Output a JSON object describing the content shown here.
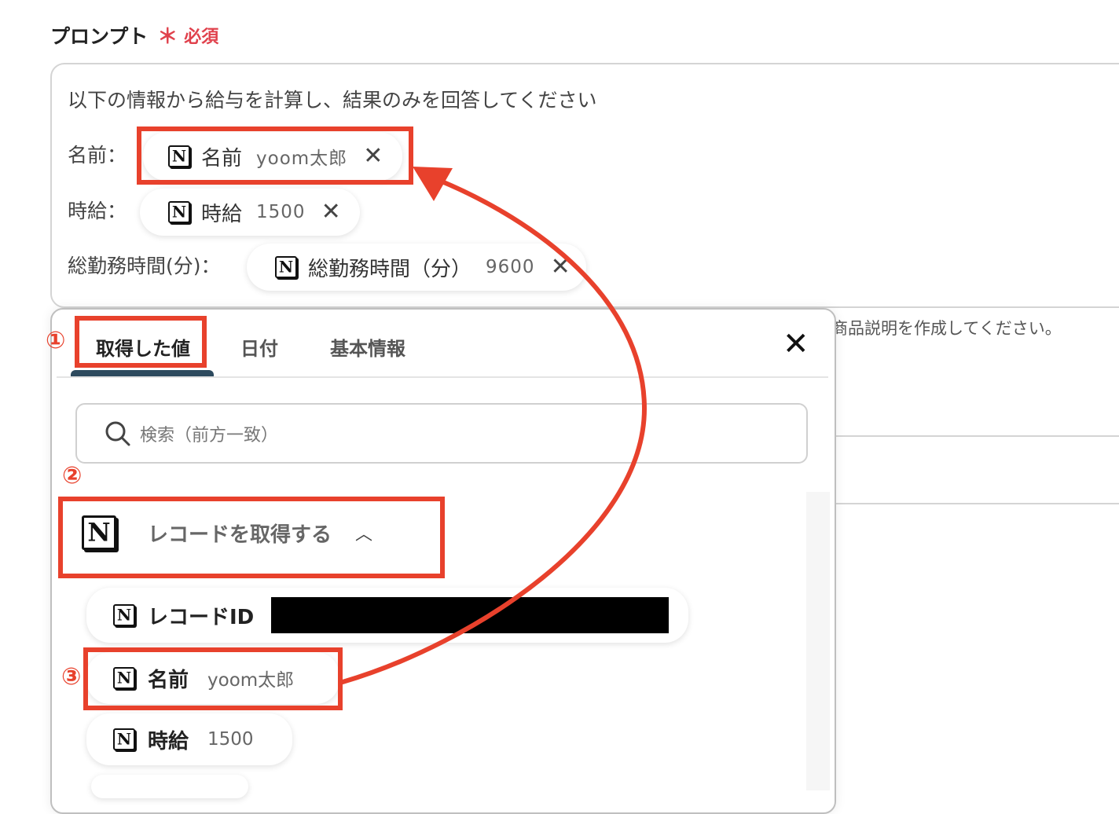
{
  "field": {
    "label": "プロンプト",
    "required_mark": "＊",
    "required_text": "必須"
  },
  "prompt": {
    "intro": "以下の情報から給与を計算し、結果のみを回答してください",
    "rows": [
      {
        "label": "名前：",
        "chip_key": "名前",
        "chip_value": "yoom太郎"
      },
      {
        "label": "時給：",
        "chip_key": "時給",
        "chip_value": "1500"
      },
      {
        "label": "総勤務時間(分)：",
        "chip_key": "総勤務時間（分）",
        "chip_value": "9600"
      }
    ]
  },
  "background": {
    "hint_text": "商品説明を作成してください。"
  },
  "popup": {
    "tabs": [
      "取得した値",
      "日付",
      "基本情報"
    ],
    "active_tab": "取得した値",
    "search_placeholder": "検索（前方一致）",
    "section": {
      "label": "レコードを取得する",
      "expanded": true
    },
    "items": [
      {
        "key": "レコードID",
        "value": "",
        "redacted": true
      },
      {
        "key": "名前",
        "value": "yoom太郎"
      },
      {
        "key": "時給",
        "value": "1500"
      }
    ]
  },
  "annotations": {
    "step1": "①",
    "step2": "②",
    "step3": "③",
    "color": "#e8412c"
  },
  "icons": {
    "notion": "N",
    "close": "✕",
    "search": "search-icon",
    "chevron": "chevron-up-icon"
  },
  "colors": {
    "accent": "#2d4a5e",
    "required": "#e0414c"
  }
}
